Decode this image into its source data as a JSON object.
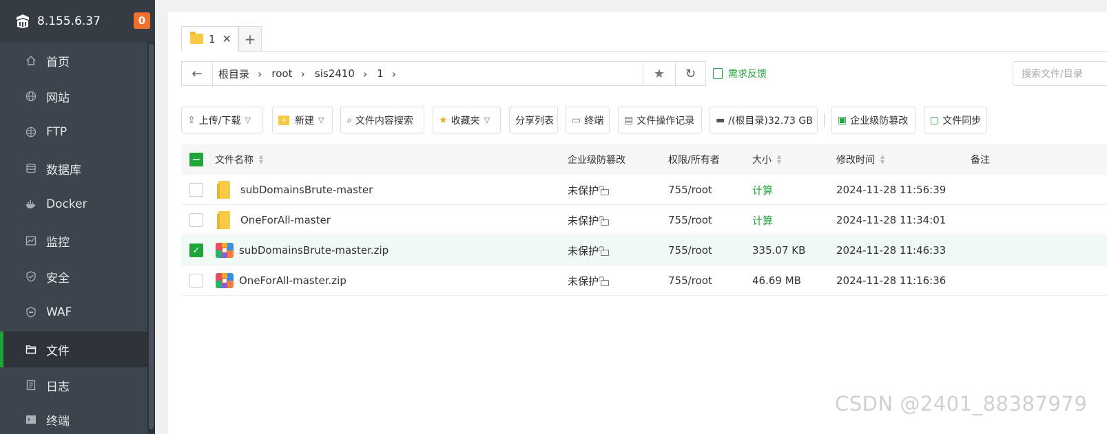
{
  "sidebar": {
    "host": "8.155.6.37",
    "badge": "0",
    "items": [
      {
        "label": "首页",
        "icon": "home-icon"
      },
      {
        "label": "网站",
        "icon": "globe-icon"
      },
      {
        "label": "FTP",
        "icon": "ftp-icon"
      },
      {
        "label": "数据库",
        "icon": "database-icon"
      },
      {
        "label": "Docker",
        "icon": "docker-icon"
      },
      {
        "label": "监控",
        "icon": "monitor-icon"
      },
      {
        "label": "安全",
        "icon": "shield-icon"
      },
      {
        "label": "WAF",
        "icon": "waf-icon"
      },
      {
        "label": "文件",
        "icon": "folder-icon",
        "active": true
      },
      {
        "label": "日志",
        "icon": "log-icon"
      },
      {
        "label": "终端",
        "icon": "terminal-icon"
      }
    ]
  },
  "tabs": [
    {
      "label": "1"
    }
  ],
  "path": {
    "crumbs": [
      "根目录",
      "root",
      "sis2410",
      "1"
    ]
  },
  "feedback": "需求反馈",
  "search": {
    "placeholder": "搜索文件/目录"
  },
  "toolbar": {
    "upload": "上传/下载",
    "create": "新建",
    "content_search": "文件内容搜索",
    "favorites": "收藏夹",
    "share_list": "分享列表",
    "terminal": "终端",
    "op_log": "文件操作记录",
    "disk": "/(根目录)32.73 GB",
    "tamper": "企业级防篡改",
    "sync": "文件同步"
  },
  "table": {
    "headers": {
      "name": "文件名称",
      "tamper": "企业级防篡改",
      "perm": "权限/所有者",
      "size": "大小",
      "mtime": "修改时间",
      "note": "备注"
    },
    "rows": [
      {
        "name": "subDomainsBrute-master",
        "type": "folder",
        "tamper": "未保护",
        "perm": "755/root",
        "size": "计算",
        "mtime": "2024-11-28 11:56:39",
        "checked": false
      },
      {
        "name": "OneForAll-master",
        "type": "folder",
        "tamper": "未保护",
        "perm": "755/root",
        "size": "计算",
        "mtime": "2024-11-28 11:34:01",
        "checked": false
      },
      {
        "name": "subDomainsBrute-master.zip",
        "type": "zip",
        "tamper": "未保护",
        "perm": "755/root",
        "size": "335.07 KB",
        "mtime": "2024-11-28 11:46:33",
        "checked": true
      },
      {
        "name": "OneForAll-master.zip",
        "type": "zip",
        "tamper": "未保护",
        "perm": "755/root",
        "size": "46.69 MB",
        "mtime": "2024-11-28 11:16:36",
        "checked": false
      }
    ]
  },
  "watermark": "CSDN @2401_88387979",
  "colors": {
    "accent": "#20a53a",
    "sidebar": "#3c444d",
    "badge": "#f0712c"
  }
}
